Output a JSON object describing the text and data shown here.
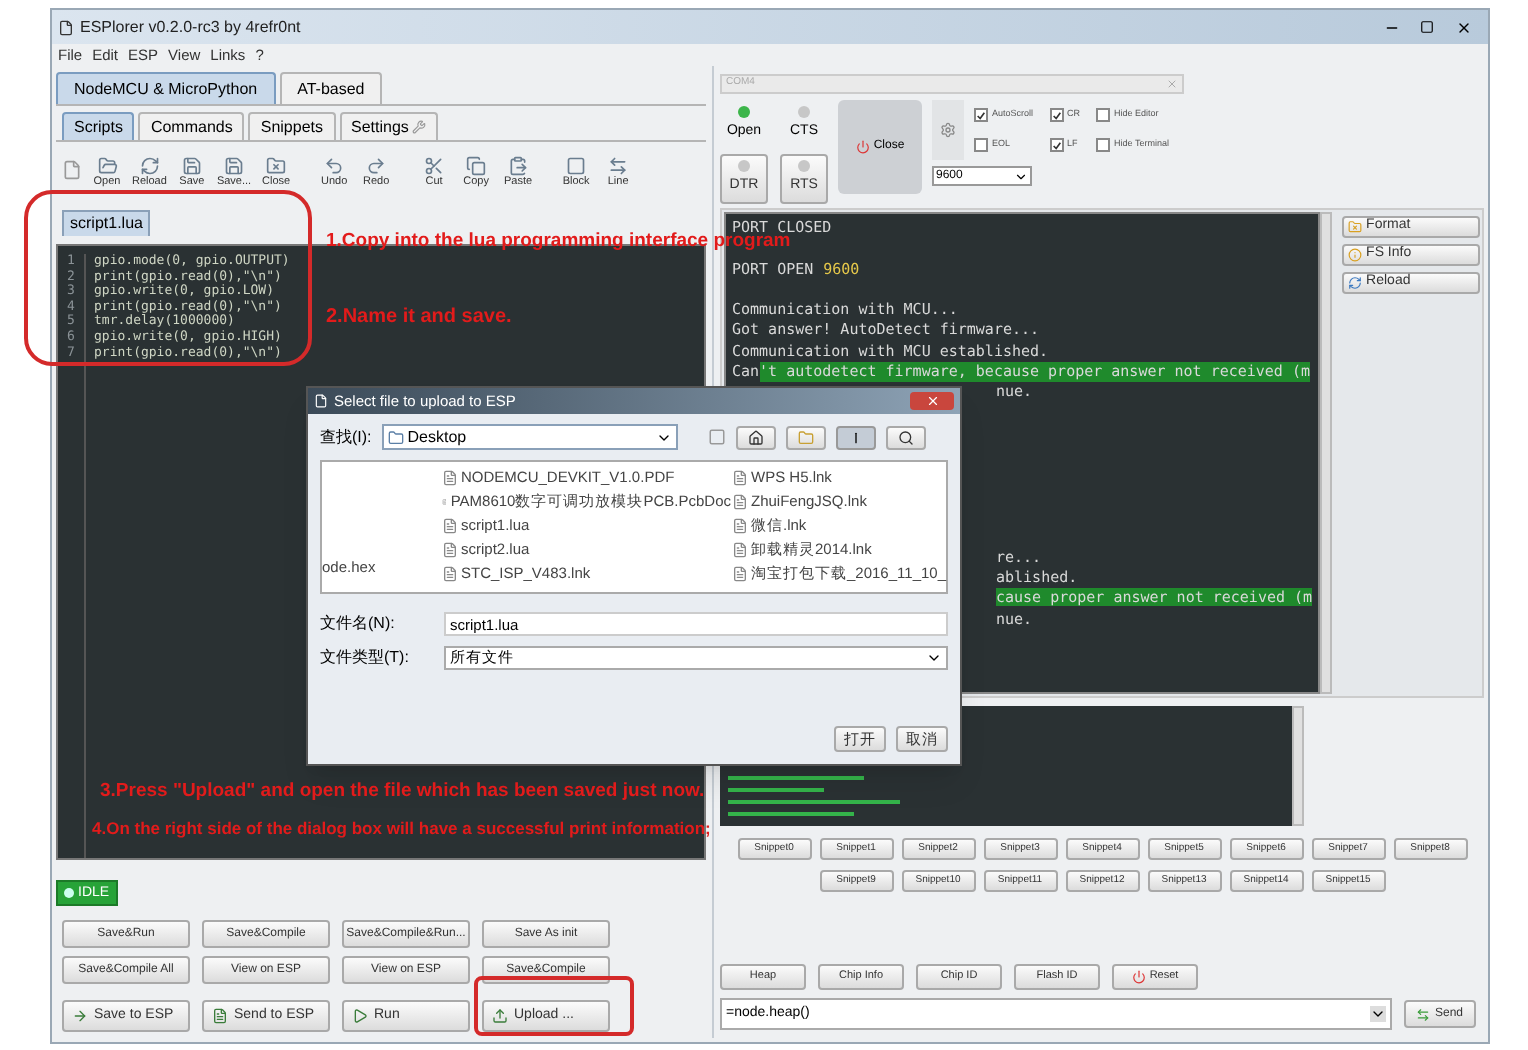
{
  "window": {
    "title": "ESPlorer v0.2.0-rc3 by 4refr0nt"
  },
  "menu": [
    "File",
    "Edit",
    "ESP",
    "View",
    "Links",
    "?"
  ],
  "mode_tabs": [
    {
      "label": "NodeMCU & MicroPython",
      "selected": true
    },
    {
      "label": "AT-based",
      "selected": false
    }
  ],
  "sub_tabs": [
    {
      "label": "Scripts",
      "selected": true
    },
    {
      "label": "Commands",
      "selected": false
    },
    {
      "label": "Snippets",
      "selected": false
    },
    {
      "label": "Settings",
      "selected": false
    }
  ],
  "toolbar": [
    "Open",
    "Reload",
    "Save",
    "Save...",
    "Close",
    "Undo",
    "Redo",
    "Cut",
    "Copy",
    "Paste",
    "Block",
    "Line"
  ],
  "file_tab": {
    "label": "script1.lua",
    "selected": true
  },
  "line_numbers": [
    "1",
    "2",
    "3",
    "4",
    "5",
    "6",
    "7"
  ],
  "code": [
    "gpio.mode(0, gpio.OUTPUT)",
    "print(gpio.read(0),\"\\n\")",
    "gpio.write(0, gpio.LOW)",
    "print(gpio.read(0),\"\\n\")",
    "tmr.delay(1000000)",
    "gpio.write(0, gpio.HIGH)",
    "print(gpio.read(0),\"\\n\")"
  ],
  "status": {
    "label": "IDLE"
  },
  "script_buttons": [
    [
      "Save&Run",
      "Save&Compile",
      "Save&Compile&Run...",
      "Save As init"
    ],
    [
      "Save&Compile All",
      "View on ESP",
      "View on ESP",
      "Save&Compile"
    ]
  ],
  "action_buttons": [
    "Save to ESP",
    "Send to ESP",
    "Run",
    "Upload ..."
  ],
  "port": {
    "value": "COM4"
  },
  "leds": [
    {
      "label": "Open",
      "on": true
    },
    {
      "label": "CTS",
      "on": false
    },
    {
      "label": "DTR",
      "on": false
    },
    {
      "label": "RTS",
      "on": false
    }
  ],
  "close_button": "Close",
  "checkboxes": [
    {
      "label": "AutoScroll",
      "checked": true
    },
    {
      "label": "EOL",
      "checked": false
    },
    {
      "label": "CR",
      "checked": true
    },
    {
      "label": "LF",
      "checked": true
    },
    {
      "label": "Hide Editor",
      "checked": false
    },
    {
      "label": "Hide Terminal",
      "checked": false
    }
  ],
  "baud": {
    "value": "9600"
  },
  "terminal": [
    {
      "kind": "line",
      "text": "PORT CLOSED"
    },
    {
      "kind": "blank"
    },
    {
      "kind": "port",
      "text": "PORT OPEN",
      "value": "9600"
    },
    {
      "kind": "blank"
    },
    {
      "kind": "line",
      "text": "Communication with MCU..."
    },
    {
      "kind": "line",
      "text": "Got answer! AutoDetect firmware..."
    },
    {
      "kind": "line",
      "text": "Communication with MCU established."
    },
    {
      "kind": "highlight",
      "text": "Can",
      "highlight": "'t autodetect firmware, because proper answer not received (m"
    },
    {
      "kind": "partial",
      "text": "nue."
    },
    {
      "kind": "blank"
    },
    {
      "kind": "blank"
    },
    {
      "kind": "blank"
    },
    {
      "kind": "blank"
    },
    {
      "kind": "blank"
    },
    {
      "kind": "blank"
    },
    {
      "kind": "blank"
    },
    {
      "kind": "partial",
      "text": "re..."
    },
    {
      "kind": "partial",
      "text": "ablished."
    },
    {
      "kind": "partial_highlight",
      "text": "cause proper answer not received (m"
    },
    {
      "kind": "partial",
      "text": "nue."
    }
  ],
  "side_buttons": [
    "Format",
    "FS Info",
    "Reload"
  ],
  "snippets": [
    [
      "Snippet0",
      "Snippet1",
      "Snippet2",
      "Snippet3",
      "Snippet4",
      "Snippet5",
      "Snippet6",
      "Snippet7",
      "Snippet8"
    ],
    [
      "Snippet9",
      "Snippet10",
      "Snippet11",
      "Snippet12",
      "Snippet13",
      "Snippet14",
      "Snippet15"
    ]
  ],
  "device_buttons": [
    "Heap",
    "Chip Info",
    "Chip ID",
    "Flash ID",
    "Reset"
  ],
  "command": {
    "value": "=node.heap()"
  },
  "send_button": "Send",
  "dialog": {
    "title": "Select file to upload to ESP",
    "look_in_label": "查找(I):",
    "look_in": "Desktop",
    "files_left": [
      "ode.hex"
    ],
    "files": [
      [
        "NODEMCU_DEVKIT_V1.0.PDF",
        "PAM8610数字可调功放模块PCB.PcbDoc",
        "script1.lua",
        "script2.lua",
        "STC_ISP_V483.lnk"
      ],
      [
        "WPS H5.lnk",
        "ZhuiFengJSQ.lnk",
        "微信.lnk",
        "卸载精灵2014.lnk",
        "淘宝打包下载_2016_11_10_"
      ]
    ],
    "file_name_label": "文件名(N):",
    "file_name": "script1.lua",
    "file_type_label": "文件类型(T):",
    "file_type": "所有文件",
    "buttons": [
      "打开",
      "取消"
    ]
  },
  "annotations": [
    "1.Copy into the lua programming interface program",
    "2.Name it and save.",
    "3.Press \"Upload\" and open the file which has been saved just now.",
    "4.On the right side of the dialog box will have a successful print information;"
  ]
}
